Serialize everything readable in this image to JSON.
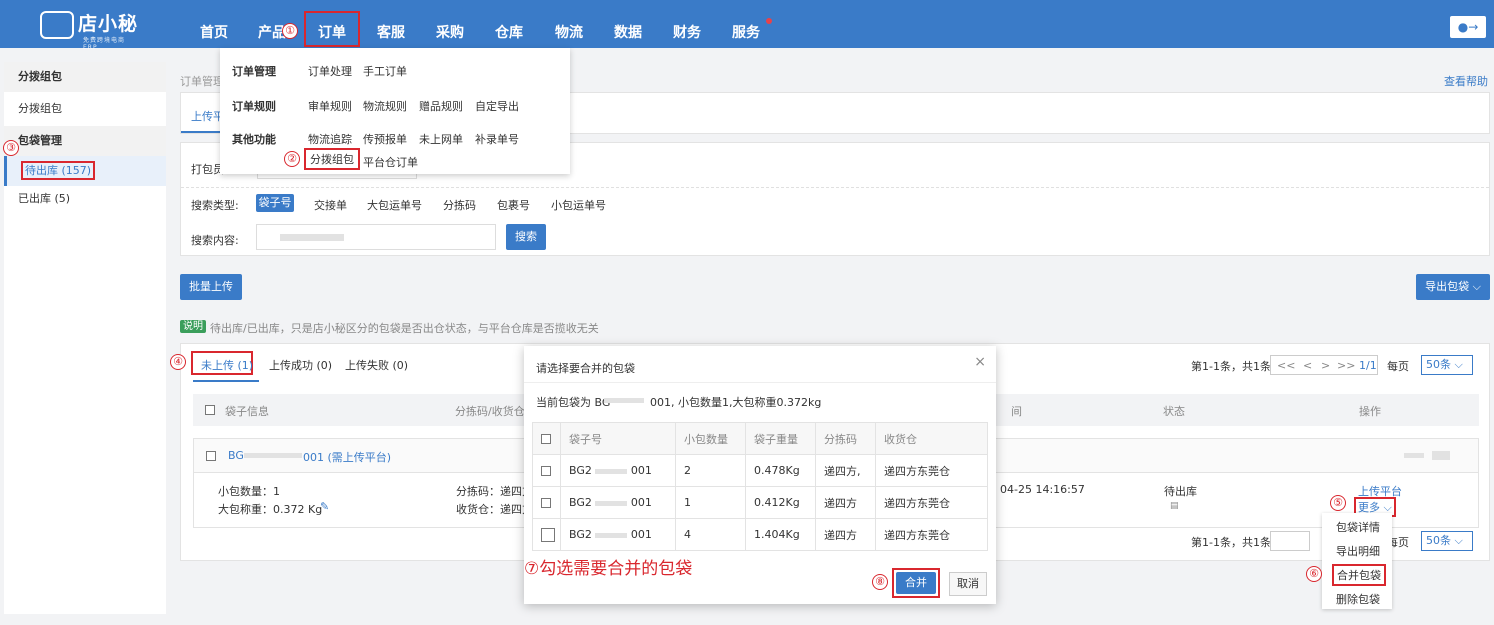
{
  "brand": {
    "name": "店小秘",
    "tagline": "免费跨境电商ERP"
  },
  "nav": [
    "首页",
    "产品",
    "订单",
    "客服",
    "采购",
    "仓库",
    "物流",
    "数据",
    "财务",
    "服务"
  ],
  "dropdown": {
    "rows": [
      {
        "title": "订单管理",
        "items": [
          "订单处理",
          "手工订单"
        ]
      },
      {
        "title": "订单规则",
        "items": [
          "审单规则",
          "物流规则",
          "赠品规则",
          "自定导出"
        ]
      },
      {
        "title": "其他功能",
        "items": [
          "物流追踪",
          "传预报单",
          "未上网单",
          "补录单号"
        ]
      }
    ],
    "extra": [
      "分拨组包",
      "平台仓订单"
    ]
  },
  "sidebar": {
    "section1": "分拨组包",
    "item1": "分拨组包",
    "section2": "包袋管理",
    "item2": "待出库 (157)",
    "item3": "已出库 (5)"
  },
  "breadcrumb": "订单管理",
  "help": "查看帮助",
  "uploadTab": "上传平",
  "filter": {
    "packLabel": "打包员",
    "typeLabel": "搜索类型:",
    "types": [
      "袋子号",
      "交接单",
      "大包运单号",
      "分拣码",
      "包裹号",
      "小包运单号"
    ],
    "contentLabel": "搜索内容:",
    "searchBtn": "搜索"
  },
  "batchBtn": "批量上传",
  "exportBtn": "导出包袋",
  "note": {
    "tag": "说明",
    "text": "待出库/已出库，只是店小秘区分的包袋是否出仓状态，与平台仓库是否揽收无关"
  },
  "tabs": [
    "未上传 (1)",
    "上传成功 (0)",
    "上传失败 (0)"
  ],
  "pager": {
    "summary": "第1-1条，共1条",
    "buttons": [
      "<<",
      "<",
      ">",
      ">>"
    ],
    "page": "1/1",
    "perLabel": "每页",
    "per": "50条"
  },
  "table": {
    "headers": [
      "袋子信息",
      "分拣码/收货仓",
      "间",
      "状态",
      "操作"
    ],
    "bag": "BG",
    "bagTail": "001 (需上传平台)",
    "qty": "小包数量：1",
    "weight": "大包称重：0.372 Kg",
    "sortCode": "分拣码：递四方",
    "warehouse": "收货仓：递四方",
    "time": "04-25 14:16:57",
    "status": "待出库",
    "op1": "上传平台",
    "more": "更多"
  },
  "menu": [
    "包袋详情",
    "导出明细",
    "合并包袋",
    "删除包袋"
  ],
  "modal": {
    "title": "请选择要合并的包袋",
    "close": "×",
    "info": "当前包袋为 BG",
    "infoTail": "001, 小包数量1,大包称重0.372kg",
    "headers": [
      "袋子号",
      "小包数量",
      "袋子重量",
      "分拣码",
      "收货仓"
    ],
    "rows": [
      [
        "BG2",
        "001",
        "2",
        "0.478Kg",
        "递四方,",
        "递四方东莞仓"
      ],
      [
        "BG2",
        "001",
        "1",
        "0.412Kg",
        "递四方",
        "递四方东莞仓"
      ],
      [
        "BG2",
        "001",
        "4",
        "1.404Kg",
        "递四方",
        "递四方东莞仓"
      ]
    ],
    "merge": "合并",
    "cancel": "取消"
  },
  "annot": {
    "c1": "①",
    "c2": "②",
    "c3": "③",
    "c4": "④",
    "c5": "⑤",
    "c6": "⑥",
    "c7": "⑦",
    "c8": "⑧",
    "hint": "勾选需要合并的包袋"
  },
  "colors": {
    "primary": "#3a7bc8",
    "annotation": "#d9272e"
  }
}
